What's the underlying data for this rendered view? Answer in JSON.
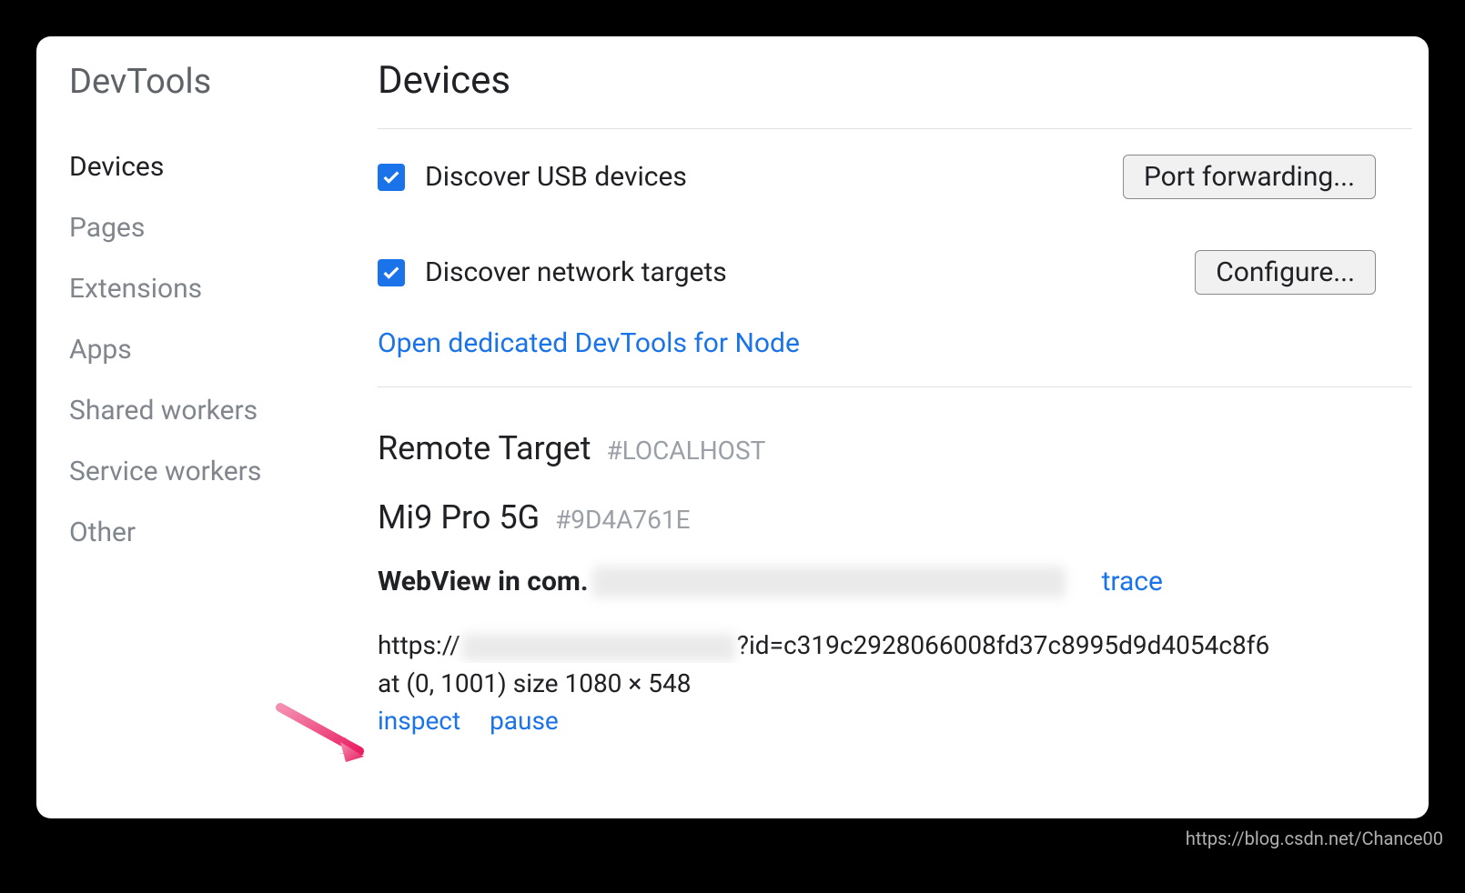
{
  "sidebar": {
    "title": "DevTools",
    "items": [
      {
        "label": "Devices",
        "active": true
      },
      {
        "label": "Pages"
      },
      {
        "label": "Extensions"
      },
      {
        "label": "Apps"
      },
      {
        "label": "Shared workers"
      },
      {
        "label": "Service workers"
      },
      {
        "label": "Other"
      }
    ]
  },
  "main": {
    "title": "Devices",
    "options": {
      "usb": {
        "label": "Discover USB devices",
        "checked": true,
        "button": "Port forwarding..."
      },
      "network": {
        "label": "Discover network targets",
        "checked": true,
        "button": "Configure..."
      }
    },
    "node_link": "Open dedicated DevTools for Node",
    "remote": {
      "title": "Remote Target",
      "hash": "#LOCALHOST"
    },
    "device": {
      "name": "Mi9 Pro 5G",
      "hash": "#9D4A761E"
    },
    "webview": {
      "prefix": "WebView in com.",
      "trace": "trace"
    },
    "url": {
      "prefix": "https://",
      "suffix_start": "?id=c319c2928066008fd37c8995d9d4054c8f6"
    },
    "dimensions": "at (0, 1001)  size 1080 × 548",
    "actions": {
      "inspect": "inspect",
      "pause": "pause"
    }
  },
  "watermark": "https://blog.csdn.net/Chance00"
}
